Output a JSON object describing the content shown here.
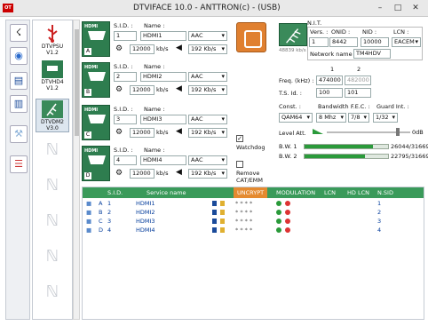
{
  "window": {
    "title": "DTVIFACE 10.0 - ANTTRON(c) - (USB)",
    "app_icon": "OT",
    "min": "–",
    "max": "□",
    "close": "✕"
  },
  "devices": [
    {
      "name": "DTVPSU",
      "version": "V1.2"
    },
    {
      "name": "DTVHD4",
      "version": "V1.2"
    },
    {
      "name": "DTVDM2",
      "version": "V3.0"
    }
  ],
  "channels": [
    {
      "letter": "A",
      "sid_label": "S.I.D. :",
      "name_label": "Name :",
      "sid": "1",
      "name": "HDMI1",
      "audio": "AAC",
      "rate": "12000",
      "rate_unit": "kb/s",
      "abitrate": "192 Kb/s"
    },
    {
      "letter": "B",
      "sid_label": "S.I.D. :",
      "name_label": "Name :",
      "sid": "2",
      "name": "HDMI2",
      "audio": "AAC",
      "rate": "12000",
      "rate_unit": "kb/s",
      "abitrate": "192 Kb/s"
    },
    {
      "letter": "C",
      "sid_label": "S.I.D. :",
      "name_label": "Name :",
      "sid": "3",
      "name": "HDMI3",
      "audio": "AAC",
      "rate": "12000",
      "rate_unit": "kb/s",
      "abitrate": "192 Kb/s"
    },
    {
      "letter": "D",
      "sid_label": "S.I.D. :",
      "name_label": "Name :",
      "sid": "4",
      "name": "HDMI4",
      "audio": "AAC",
      "rate": "12000",
      "rate_unit": "kb/s",
      "abitrate": "192 Kb/s"
    }
  ],
  "hdmi_label": "HDMI",
  "watchdog": {
    "label": "Watchdog",
    "checked": true
  },
  "remove_cat": {
    "label": "Remove CAT/EMM",
    "checked": false
  },
  "modulator": {
    "antenna_rate": "48839 kb/s",
    "nit_label": "N.I.T.",
    "vers_label": "Vers. :",
    "vers": "1",
    "onid_label": "ONID :",
    "onid": "8442",
    "nid_label": "NID :",
    "nid": "10000",
    "lcn_label": "LCN :",
    "lcn": "EACEM",
    "network_label": "Network name :",
    "network": "TM4HDV",
    "col1": "1",
    "col2": "2",
    "freq_label": "Freq. (kHz) :",
    "freq1": "474000",
    "freq2": "482000",
    "tsid_label": "T.S. Id. :",
    "tsid1": "100",
    "tsid2": "101",
    "const_label": "Const. :",
    "bw_label": "Bandwidth :",
    "fec_label": "F.E.C. :",
    "guard_label": "Guard Int. :",
    "const": "QAM64",
    "bw": "8 Mhz",
    "fec": "7/8",
    "guard": "1/32",
    "level_label": "Level Att.",
    "level_value": "0dB",
    "bw1_label": "B.W. 1",
    "bw1_value": "26044/31669",
    "bw1_fraction": 0.822,
    "bw2_label": "B.W. 2",
    "bw2_value": "22795/31669",
    "bw2_fraction": 0.72
  },
  "table": {
    "headers": [
      "S.I.D.",
      "Service name",
      "UNCRYPT",
      "MODULATION",
      "LCN",
      "HD LCN",
      "N.SID"
    ],
    "rows": [
      {
        "input": "A",
        "sid": "1",
        "name": "HDMI1",
        "nsid": "1"
      },
      {
        "input": "B",
        "sid": "2",
        "name": "HDMI2",
        "nsid": "2"
      },
      {
        "input": "C",
        "sid": "3",
        "name": "HDMI3",
        "nsid": "3"
      },
      {
        "input": "D",
        "sid": "4",
        "name": "HDMI4",
        "nsid": "4"
      }
    ],
    "stars": "* * * *"
  }
}
